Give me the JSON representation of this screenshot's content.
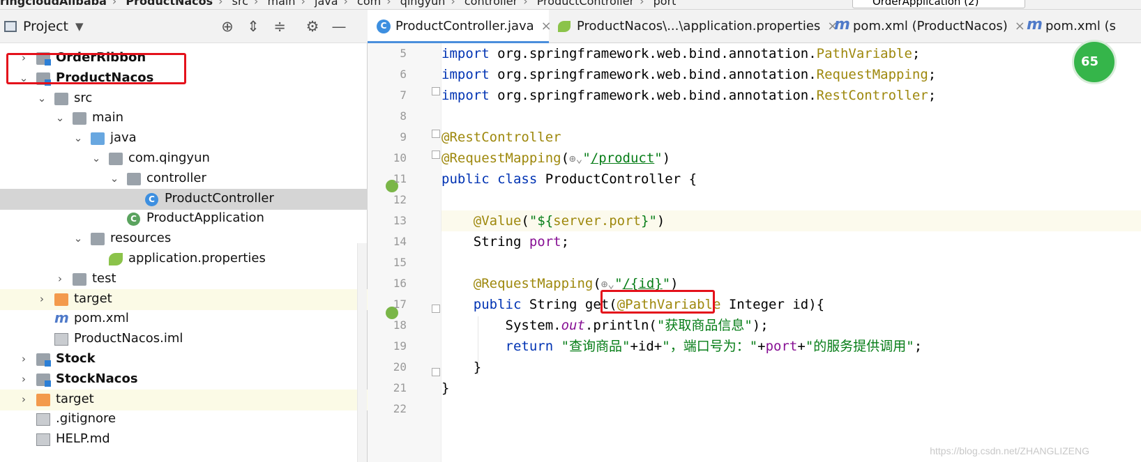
{
  "breadcrumbs": [
    "ringcloudAlibaba",
    "ProductNacos",
    "src",
    "main",
    "java",
    "com",
    "qingyun",
    "controller",
    "ProductController",
    "port"
  ],
  "run_config": "OrderApplication (2)",
  "project_panel": {
    "title": "Project",
    "tree": [
      {
        "label": "OrderRibbon",
        "depth": 0,
        "arrow": "›",
        "icon": "module-folder-icon",
        "bold": true
      },
      {
        "label": "ProductNacos",
        "depth": 0,
        "arrow": "⌄",
        "icon": "module-folder-icon",
        "bold": true
      },
      {
        "label": "src",
        "depth": 1,
        "arrow": "⌄",
        "icon": "folder-icon"
      },
      {
        "label": "main",
        "depth": 2,
        "arrow": "⌄",
        "icon": "folder-icon"
      },
      {
        "label": "java",
        "depth": 3,
        "arrow": "⌄",
        "icon": "source-folder-icon"
      },
      {
        "label": "com.qingyun",
        "depth": 4,
        "arrow": "⌄",
        "icon": "package-icon"
      },
      {
        "label": "controller",
        "depth": 5,
        "arrow": "⌄",
        "icon": "package-icon"
      },
      {
        "label": "ProductController",
        "depth": 6,
        "arrow": "",
        "icon": "class-icon",
        "selected": true
      },
      {
        "label": "ProductApplication",
        "depth": 5,
        "arrow": "",
        "icon": "spring-class-icon"
      },
      {
        "label": "resources",
        "depth": 3,
        "arrow": "⌄",
        "icon": "resources-folder-icon"
      },
      {
        "label": "application.properties",
        "depth": 4,
        "arrow": "",
        "icon": "properties-file-icon"
      },
      {
        "label": "test",
        "depth": 2,
        "arrow": "›",
        "icon": "folder-icon"
      },
      {
        "label": "target",
        "depth": 1,
        "arrow": "›",
        "icon": "excluded-folder-icon",
        "highlight": true
      },
      {
        "label": "pom.xml",
        "depth": 1,
        "arrow": "",
        "icon": "maven-icon"
      },
      {
        "label": "ProductNacos.iml",
        "depth": 1,
        "arrow": "",
        "icon": "iml-file-icon"
      },
      {
        "label": "Stock",
        "depth": 0,
        "arrow": "›",
        "icon": "module-folder-icon",
        "bold": true
      },
      {
        "label": "StockNacos",
        "depth": 0,
        "arrow": "›",
        "icon": "module-folder-icon",
        "bold": true
      },
      {
        "label": "target",
        "depth": 0,
        "arrow": "›",
        "icon": "excluded-folder-icon",
        "highlight": true
      },
      {
        "label": ".gitignore",
        "depth": 0,
        "arrow": "",
        "icon": "gitignore-file-icon"
      },
      {
        "label": "HELP.md",
        "depth": 0,
        "arrow": "",
        "icon": "markdown-file-icon"
      }
    ]
  },
  "tabs": [
    {
      "label": "ProductController.java",
      "icon": "class-icon",
      "active": true
    },
    {
      "label": "ProductNacos\\...\\application.properties",
      "icon": "properties-file-icon"
    },
    {
      "label": "pom.xml (ProductNacos)",
      "icon": "maven-icon"
    },
    {
      "label": "pom.xml (s",
      "icon": "maven-icon"
    }
  ],
  "editor": {
    "line_numbers": [
      "5",
      "6",
      "7",
      "8",
      "9",
      "10",
      "11",
      "12",
      "13",
      "14",
      "15",
      "16",
      "17",
      "18",
      "19",
      "20",
      "21",
      "22"
    ],
    "code": {
      "l5a": "import ",
      "l5b": "org.springframework.web.bind.annotation.",
      "l5c": "PathVariable",
      "l5d": ";",
      "l6a": "import ",
      "l6b": "org.springframework.web.bind.annotation.",
      "l6c": "RequestMapping",
      "l6d": ";",
      "l7a": "import ",
      "l7b": "org.springframework.web.bind.annotation.",
      "l7c": "RestController",
      "l7d": ";",
      "l9": "@RestController",
      "l10a": "@RequestMapping",
      "l10b": "(",
      "l10c": "\"",
      "l10d": "/product",
      "l10e": "\"",
      "l10f": ")",
      "l11a": "public class ",
      "l11b": "ProductController {",
      "l13a": "    @Value",
      "l13b": "(",
      "l13c": "\"${",
      "l13d": "server.port",
      "l13e": "}\"",
      "l13f": ")",
      "l14a": "    String ",
      "l14b": "port",
      "l14c": ";",
      "l16a": "    @RequestMapping",
      "l16b": "(",
      "l16c": "\"",
      "l16d": "/{id}",
      "l16e": "\"",
      "l16f": ")",
      "l17a": "    public ",
      "l17b": "String get(",
      "l17c": "@PathVariable",
      "l17d": " Integer id){",
      "l18a": "        System.",
      "l18b": "out",
      "l18c": ".println(",
      "l18d": "\"获取商品信息\"",
      "l18e": ");",
      "l19a": "        return ",
      "l19b": "\"查询商品\"",
      "l19c": "+id+",
      "l19d": "\"，端口号为：\"",
      "l19e": "+",
      "l19f": "port",
      "l19g": "+",
      "l19h": "\"的服务提供调用\"",
      "l19i": ";",
      "l20": "    }",
      "l21": "}"
    }
  },
  "badge_value": "65",
  "watermark": "https://blog.csdn.net/ZHANGLIZENG"
}
